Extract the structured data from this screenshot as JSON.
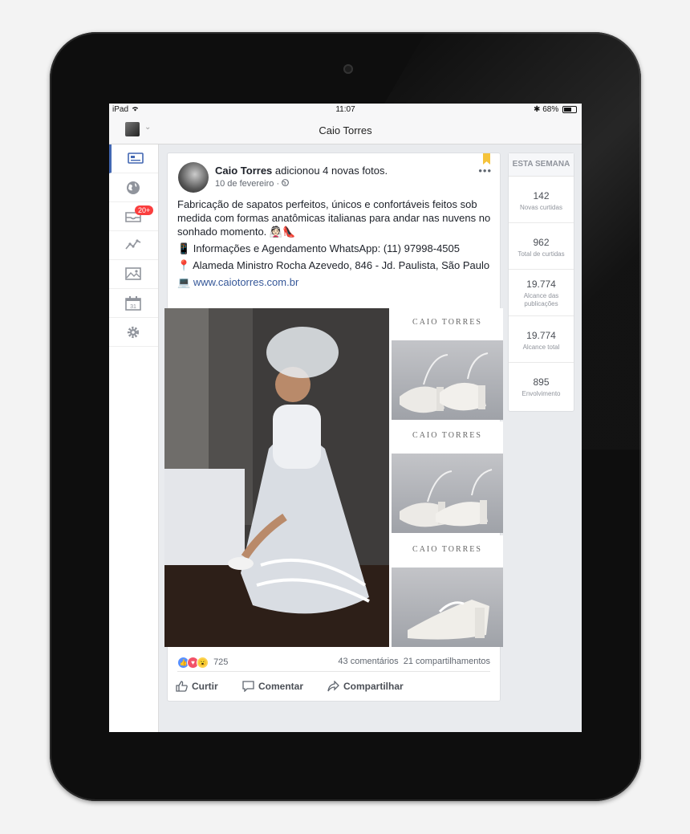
{
  "status_bar": {
    "device": "iPad",
    "time": "11:07",
    "battery": "68%"
  },
  "header": {
    "title": "Caio Torres"
  },
  "sidebar": {
    "badge": "20+"
  },
  "post": {
    "author": "Caio Torres",
    "action": "adicionou 4 novas fotos.",
    "date": "10 de fevereiro",
    "text_1": "Fabricação de sapatos perfeitos, únicos e confortáveis feitos sob medida com formas anatômicas italianas para andar nas nuvens no sonhado momento. 👰🏻👠",
    "text_2": "📱 Informações e Agendamento WhatsApp: (11) 97998-4505",
    "text_3": "📍 Alameda Ministro Rocha Azevedo, 846 - Jd. Paulista, São Paulo",
    "link_icon": "💻",
    "link": "www.caiotorres.com.br",
    "photo_brand": "CAIO TORRES",
    "reactions_count": "725",
    "comments": "43 comentários",
    "shares": "21 compartilhamentos",
    "like_label": "Curtir",
    "comment_label": "Comentar",
    "share_label": "Compartilhar"
  },
  "stats": {
    "heading": "ESTA SEMANA",
    "items": [
      {
        "value": "142",
        "label": "Novas curtidas"
      },
      {
        "value": "962",
        "label": "Total de curtidas"
      },
      {
        "value": "19.774",
        "label": "Alcance das publicações"
      },
      {
        "value": "19.774",
        "label": "Alcance total"
      },
      {
        "value": "895",
        "label": "Envolvimento"
      }
    ]
  },
  "colors": {
    "accent": "#4267b2",
    "link": "#365899",
    "badge": "#fa3e3e",
    "bookmark": "#f5c33b"
  }
}
